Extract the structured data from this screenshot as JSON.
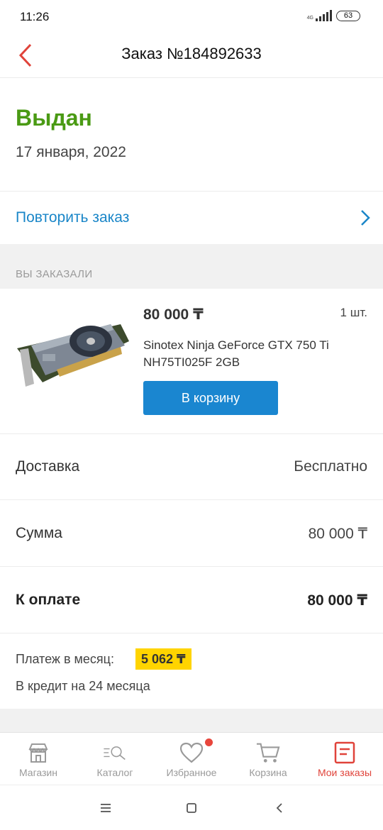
{
  "status_bar": {
    "time": "11:26",
    "network": "4G",
    "battery": "63"
  },
  "header": {
    "title": "Заказ №184892633"
  },
  "order": {
    "status": "Выдан",
    "date": "17 января, 2022",
    "repeat_label": "Повторить заказ"
  },
  "items_section": {
    "title": "ВЫ ЗАКАЗАЛИ"
  },
  "product": {
    "price": "80 000 ₸",
    "qty": "1 шт.",
    "name": "Sinotex Ninja GeForce GTX 750 Ti NH75TI025F 2GB",
    "cart_button": "В корзину"
  },
  "summary": {
    "delivery_label": "Доставка",
    "delivery_value": "Бесплатно",
    "sum_label": "Сумма",
    "sum_value": "80 000 ₸",
    "total_label": "К оплате",
    "total_value": "80 000 ₸"
  },
  "credit": {
    "monthly_label": "Платеж в месяц:",
    "monthly_value": "5 062 ₸",
    "term": "В кредит на 24 месяца"
  },
  "tabs": [
    {
      "label": "Магазин",
      "icon": "store-icon"
    },
    {
      "label": "Каталог",
      "icon": "catalog-search-icon"
    },
    {
      "label": "Избранное",
      "icon": "heart-icon"
    },
    {
      "label": "Корзина",
      "icon": "cart-icon"
    },
    {
      "label": "Мои заказы",
      "icon": "orders-icon"
    }
  ],
  "colors": {
    "accent_blue": "#1a86c8",
    "status_green": "#4a9a14",
    "active_tab": "#e0433a",
    "badge_yellow": "#ffd400"
  }
}
